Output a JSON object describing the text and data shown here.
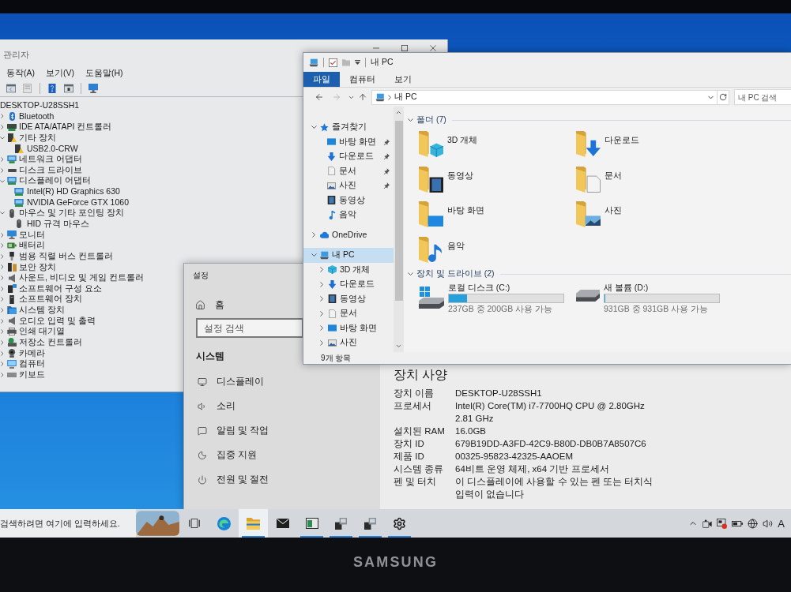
{
  "device_manager": {
    "title": "관리자",
    "menu": [
      "동작(A)",
      "보기(V)",
      "도움말(H)"
    ],
    "tree": {
      "label": "DESKTOP-U28SSH1",
      "children": [
        {
          "label": "Bluetooth",
          "expanded": false
        },
        {
          "label": "IDE ATA/ATAPI 컨트롤러",
          "expanded": false
        },
        {
          "label": "기타 장치",
          "expanded": true,
          "children": [
            {
              "label": "USB2.0-CRW"
            }
          ]
        },
        {
          "label": "네트워크 어댑터",
          "expanded": false
        },
        {
          "label": "디스크 드라이브",
          "expanded": false
        },
        {
          "label": "디스플레이 어댑터",
          "expanded": true,
          "children": [
            {
              "label": "Intel(R) HD Graphics 630"
            },
            {
              "label": "NVIDIA GeForce GTX 1060"
            }
          ]
        },
        {
          "label": "마우스 및 기타 포인팅 장치",
          "expanded": true,
          "children": [
            {
              "label": "HID 규격 마우스"
            }
          ]
        },
        {
          "label": "모니터",
          "expanded": false
        },
        {
          "label": "배터리",
          "expanded": false
        },
        {
          "label": "범용 직렬 버스 컨트롤러",
          "expanded": false
        },
        {
          "label": "보안 장치",
          "expanded": false
        },
        {
          "label": "사운드, 비디오 및 게임 컨트롤러",
          "expanded": false
        },
        {
          "label": "소프트웨어 구성 요소",
          "expanded": false
        },
        {
          "label": "소프트웨어 장치",
          "expanded": false
        },
        {
          "label": "시스템 장치",
          "expanded": false
        },
        {
          "label": "오디오 입력 및 출력",
          "expanded": false
        },
        {
          "label": "인쇄 대기열",
          "expanded": false
        },
        {
          "label": "저장소 컨트롤러",
          "expanded": false
        },
        {
          "label": "카메라",
          "expanded": false
        },
        {
          "label": "컴퓨터",
          "expanded": false
        },
        {
          "label": "키보드",
          "expanded": false
        }
      ]
    }
  },
  "explorer": {
    "title": "내 PC",
    "ribbon_tabs": [
      {
        "label": "파일",
        "selected": true
      },
      {
        "label": "컴퓨터",
        "selected": false
      },
      {
        "label": "보기",
        "selected": false
      }
    ],
    "address": [
      "내 PC"
    ],
    "search": {
      "placeholder": "내 PC 검색"
    },
    "nav": [
      {
        "label": "즐겨찾기",
        "expanded": true,
        "selected": false,
        "children": [
          {
            "label": "바탕 화면",
            "pinned": true,
            "selected": false
          },
          {
            "label": "다운로드",
            "pinned": true,
            "selected": false
          },
          {
            "label": "문서",
            "pinned": true,
            "selected": false
          },
          {
            "label": "사진",
            "pinned": true,
            "selected": false
          },
          {
            "label": "동영상",
            "pinned": false,
            "selected": false
          },
          {
            "label": "음악",
            "pinned": false,
            "selected": false
          }
        ]
      },
      {
        "label": "OneDrive",
        "expanded": false,
        "selected": false
      },
      {
        "label": "내 PC",
        "expanded": true,
        "selected": true,
        "children": [
          {
            "label": "3D 개체",
            "expanded": false,
            "selected": false
          },
          {
            "label": "다운로드",
            "expanded": false,
            "selected": false
          },
          {
            "label": "동영상",
            "expanded": false,
            "selected": false
          },
          {
            "label": "문서",
            "expanded": false,
            "selected": false
          },
          {
            "label": "바탕 화면",
            "expanded": false,
            "selected": false
          },
          {
            "label": "사진",
            "expanded": false,
            "selected": false
          }
        ]
      }
    ],
    "folders": {
      "heading": "폴더 (7)",
      "expanded": true,
      "items": [
        "3D 개체",
        "다운로드",
        "동영상",
        "문서",
        "바탕 화면",
        "사진",
        "음악"
      ]
    },
    "drives": {
      "heading": "장치 및 드라이브 (2)",
      "expanded": true,
      "items": [
        {
          "name": "로컬 디스크 (C:)",
          "level": 0.16,
          "free": "237GB 중 200GB 사용 가능"
        },
        {
          "name": "새 볼륨 (D:)",
          "level": 0,
          "free": "931GB 중 931GB 사용 가능"
        }
      ]
    },
    "status": "9개 항목"
  },
  "settings": {
    "title": "설정",
    "home": "홈",
    "search": {
      "placeholder": "설정 검색"
    },
    "section": "시스템",
    "menu": [
      "디스플레이",
      "소리",
      "알림 및 작업",
      "집중 지원",
      "전원 및 절전"
    ],
    "about": {
      "heading": "장치 사양",
      "rows": [
        {
          "label": "장치 이름",
          "value": "DESKTOP-U28SSH1"
        },
        {
          "label": "프로세서",
          "value": "Intel(R) Core(TM) i7-7700HQ CPU @ 2.80GHz 2.81 GHz"
        },
        {
          "label": "설치된 RAM",
          "value": "16.0GB"
        },
        {
          "label": "장치 ID",
          "value": "679B19DD-A3FD-42C9-B80D-DB0B7A8507C6"
        },
        {
          "label": "제품 ID",
          "value": "00325-95823-42325-AAOEM"
        },
        {
          "label": "시스템 종류",
          "value": "64비트 운영 체제, x64 기반 프로세서"
        },
        {
          "label": "펜 및 터치",
          "value": "이 디스플레이에 사용할 수 있는 펜 또는 터치식 입력이 없습니다"
        }
      ]
    }
  },
  "taskbar": {
    "search": {
      "placeholder": "검색하려면 여기에 입력하세요."
    },
    "apps": [
      {
        "running": false,
        "selected": false
      },
      {
        "running": true,
        "selected": true
      },
      {
        "running": false,
        "selected": false
      },
      {
        "running": true,
        "selected": false
      },
      {
        "running": true,
        "selected": false
      },
      {
        "running": true,
        "selected": false
      },
      {
        "running": true,
        "selected": false
      }
    ],
    "ime": "A"
  },
  "monitor": {
    "brand": "SAMSUNG"
  }
}
